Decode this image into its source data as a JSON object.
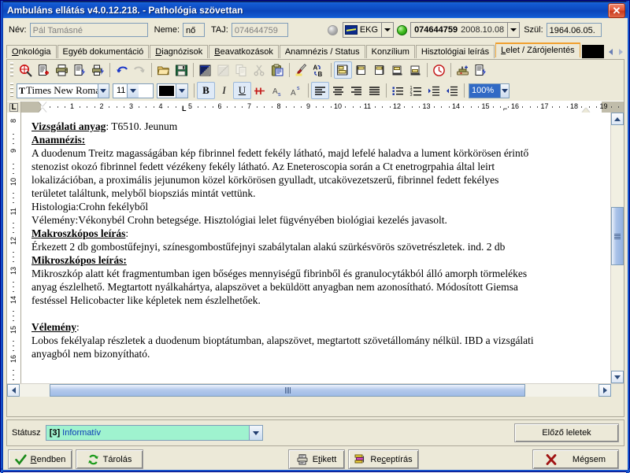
{
  "window": {
    "title": "Ambuláns ellátás v4.0.12.218. - Pathológia szövettan",
    "close_label": "✕"
  },
  "patient_header": {
    "name_label": "Név:",
    "name_value": "Pál Tamásné",
    "gender_label": "Neme:",
    "gender_value": "nő",
    "taj_label": "TAJ:",
    "taj_value": "074644759",
    "ekg_label": "EKG",
    "case_number": "074644759",
    "case_date": "2008.10.08",
    "birth_label": "Szül:",
    "birth_value": "1964.06.05."
  },
  "tabs": [
    {
      "label": "Onkológia",
      "active": false
    },
    {
      "label": "Egyéb dokumentáció",
      "active": false
    },
    {
      "label": "Diagnózisok",
      "active": false
    },
    {
      "label": "Beavatkozások",
      "active": false
    },
    {
      "label": "Anamnézis / Status",
      "active": false
    },
    {
      "label": "Konzílium",
      "active": false
    },
    {
      "label": "Hisztológiai leírás",
      "active": false
    },
    {
      "label": "Lelet / Zárójelentés",
      "active": true
    }
  ],
  "toolbar_main": [
    "zoom-icon",
    "new-document-icon",
    "print-icon",
    "print-preview-icon",
    "print-setup-icon",
    "undo-icon",
    "redo-icon",
    "open-icon",
    "save-icon",
    "select-all-icon",
    "deselect-icon",
    "copy-icon",
    "cut-icon",
    "paste-icon",
    "highlighter-icon",
    "find-replace-icon",
    "template-icon",
    "insert-before-icon",
    "insert-after-icon",
    "append-icon",
    "merge-icon",
    "clock-icon",
    "stamp-icon",
    "export-icon"
  ],
  "format_toolbar": {
    "font_name": "Times New Roma",
    "font_size": "11",
    "font_color": "#000000",
    "zoom_level": "100%",
    "bold_label": "B",
    "italic_label": "I",
    "underline_label": "U",
    "strikethrough_label": "H",
    "subscript_label": "A",
    "superscript_label": "A",
    "align_icons": [
      "align-left-icon",
      "align-center-icon",
      "align-right-icon",
      "align-justify-icon"
    ],
    "list_icons": [
      "bullet-list-icon",
      "numbered-list-icon",
      "increase-indent-icon",
      "decrease-indent-icon"
    ]
  },
  "ruler": {
    "tab_selector_glyph": "L",
    "numbers": [
      1,
      2,
      3,
      4,
      5,
      6,
      7,
      8,
      9,
      10,
      11,
      12,
      13,
      14,
      15,
      16,
      17,
      18,
      19
    ],
    "vertical_numbers": [
      8,
      9,
      10,
      11,
      12,
      13,
      14,
      15,
      16
    ]
  },
  "document": {
    "lines": [
      {
        "type": "mixed",
        "head": "Vizsgálati anyag",
        "tail": ":  T6510. Jeunum"
      },
      {
        "type": "heading",
        "text": "Anamnézis:"
      },
      {
        "type": "text",
        "text": "A duodenum Treitz magasságában kép fibrinnel fedett fekély látható, majd lefelé haladva a lument körkörösen érintő"
      },
      {
        "type": "text",
        "text": "stenozist okozó fibrinnel fedett vézékeny fekély látható. Az Eneteroscopia során a Ct enetrogrpahia által leirt"
      },
      {
        "type": "text",
        "text": "lokalizációban, a proximális jejunumon közel körkörösen gyulladt, utcakövezetszerű, fibrinnel fedett fekélyes"
      },
      {
        "type": "text",
        "text": "területet találtunk, melyből biopsziás mintát vettünk."
      },
      {
        "type": "text",
        "text": "Histologia:Crohn fekélyből"
      },
      {
        "type": "text",
        "text": "Vélemény:Vékonybél Crohn betegsége. Hisztológiai lelet fügvényében biológiai kezelés javasolt."
      },
      {
        "type": "mixed",
        "head": "Makroszkópos leírás",
        "tail": ":"
      },
      {
        "type": "text",
        "text": "Érkezett 2 db gombostűfejnyi, színesgombostűfejnyi szabálytalan alakú szürkésvörös szövetrészletek. ind. 2 db"
      },
      {
        "type": "heading",
        "text": "Mikroszkópos leírás:"
      },
      {
        "type": "text",
        "text": "Mikroszkóp alatt két fragmentumban igen bőséges mennyiségű fibrinből és granulocytákból álló amorph törmelékes"
      },
      {
        "type": "text",
        "text": "anyag észlelhető. Megtartott nyálkahártya, alapszövet a beküldött anyagban nem azonosítható. Módosított Giemsa"
      },
      {
        "type": "text",
        "text": "festéssel Helicobacter like képletek nem észlelhetőek."
      },
      {
        "type": "blank",
        "text": ""
      },
      {
        "type": "mixed",
        "head": "Vélemény",
        "tail": ":"
      },
      {
        "type": "text",
        "text": "Lobos fekélyalap részletek a duodenum bioptátumban, alapszövet, megtartott szövetállomány nélkül. IBD a vizsgálati"
      },
      {
        "type": "text",
        "text": "anyagból nem bizonyítható."
      }
    ]
  },
  "status_panel": {
    "label": "Státusz",
    "value_code": "[3]",
    "value_text": "Informatív",
    "value_bg": "#9ff3cf",
    "prev_results_label": "Előző leletek"
  },
  "buttons": {
    "ok_label": "Rendben",
    "ok_accel": "R",
    "store_label": "Tárolás",
    "label_label": "Etikett",
    "label_accel": "E",
    "prescription_label": "Receptírás",
    "prescription_accel": "c",
    "cancel_label": "Mégsem"
  },
  "colors": {
    "titlebar_blue": "#0b45ba",
    "window_face": "#ece9d8",
    "active_tab_border": "#e8a33d",
    "status_green": "#9ff3cf",
    "close_red": "#c8391c"
  }
}
